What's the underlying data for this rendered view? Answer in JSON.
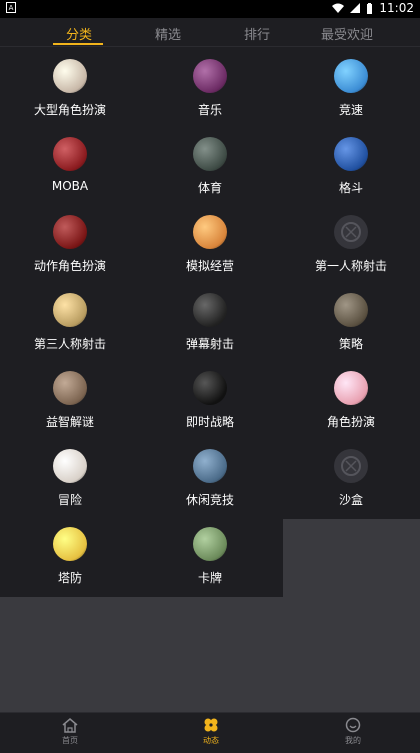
{
  "status": {
    "time": "11:02"
  },
  "tabs": [
    {
      "label": "分类"
    },
    {
      "label": "精选"
    },
    {
      "label": "排行"
    },
    {
      "label": "最受欢迎"
    }
  ],
  "categories": [
    {
      "label": "大型角色扮演",
      "icon": "mmorpg-icon",
      "color": "#c7b7a7"
    },
    {
      "label": "音乐",
      "icon": "music-icon",
      "color": "#6b2a63"
    },
    {
      "label": "竞速",
      "icon": "racing-icon",
      "color": "#3b8cd4"
    },
    {
      "label": "MOBA",
      "icon": "moba-icon",
      "color": "#8a1a1e"
    },
    {
      "label": "体育",
      "icon": "sports-icon",
      "color": "#3d4a44"
    },
    {
      "label": "格斗",
      "icon": "fighting-icon",
      "color": "#2050a0"
    },
    {
      "label": "动作角色扮演",
      "icon": "arpg-icon",
      "color": "#7a1515"
    },
    {
      "label": "模拟经营",
      "icon": "simulation-icon",
      "color": "#d8843a"
    },
    {
      "label": "第一人称射击",
      "icon": "fps-placeholder-icon",
      "color": "#3a3a40"
    },
    {
      "label": "第三人称射击",
      "icon": "tps-icon",
      "color": "#b89c60"
    },
    {
      "label": "弹幕射击",
      "icon": "bullet-hell-icon",
      "color": "#222"
    },
    {
      "label": "策略",
      "icon": "strategy-icon",
      "color": "#5a5040"
    },
    {
      "label": "益智解谜",
      "icon": "puzzle-icon",
      "color": "#7c6450"
    },
    {
      "label": "即时战略",
      "icon": "rts-icon",
      "color": "#111"
    },
    {
      "label": "角色扮演",
      "icon": "rpg-icon",
      "color": "#e8a0b0"
    },
    {
      "label": "冒险",
      "icon": "adventure-icon",
      "color": "#d8d0c8"
    },
    {
      "label": "休闲竞技",
      "icon": "casual-icon",
      "color": "#4a6a88"
    },
    {
      "label": "沙盒",
      "icon": "sandbox-placeholder-icon",
      "color": "#3a3a40"
    },
    {
      "label": "塔防",
      "icon": "tower-defense-icon",
      "color": "#e6c040"
    },
    {
      "label": "卡牌",
      "icon": "card-icon",
      "color": "#6b8a5a"
    }
  ],
  "bottom_nav": [
    {
      "label": "首页",
      "icon": "home-icon"
    },
    {
      "label": "动态",
      "icon": "flower-icon"
    },
    {
      "label": "我的",
      "icon": "profile-icon"
    }
  ],
  "colors": {
    "accent": "#f2b41c",
    "panel": "#1e1e22",
    "page": "#3a3a3f"
  }
}
